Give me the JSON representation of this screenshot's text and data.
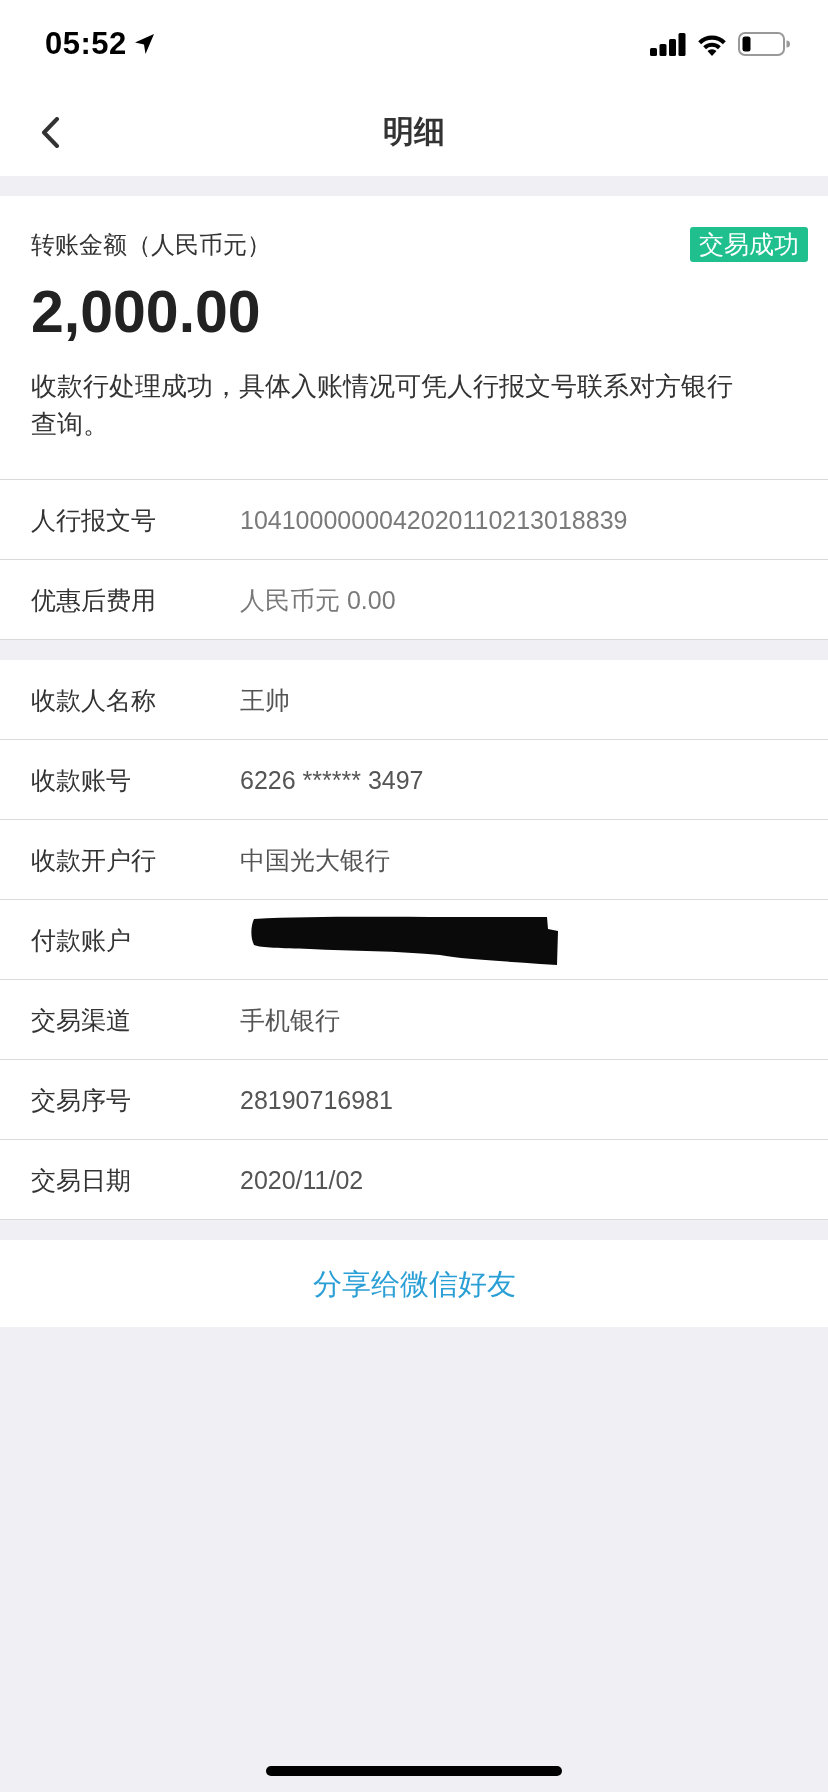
{
  "status_bar": {
    "time": "05:52"
  },
  "nav_bar": {
    "title": "明细"
  },
  "summary": {
    "label": "转账金额（人民币元）",
    "status_badge": "交易成功",
    "amount": "2,000.00",
    "note": "收款行处理成功，具体入账情况可凭人行报文号联系对方银行查询。"
  },
  "sections": [
    {
      "rows": [
        {
          "kind": "text",
          "label": "人行报文号",
          "value": "1041000000042020110213018839"
        },
        {
          "kind": "text",
          "label": "优惠后费用",
          "value": "人民币元 0.00"
        }
      ]
    },
    {
      "rows": [
        {
          "kind": "text",
          "label": "收款人名称",
          "value": "王帅"
        },
        {
          "kind": "text",
          "label": "收款账号",
          "value": "6226 ****** 3497"
        },
        {
          "kind": "text",
          "label": "收款开户行",
          "value": "中国光大银行"
        },
        {
          "kind": "redacted",
          "label": "付款账户"
        },
        {
          "kind": "text",
          "label": "交易渠道",
          "value": "手机银行"
        },
        {
          "kind": "text",
          "label": "交易序号",
          "value": "28190716981"
        },
        {
          "kind": "text",
          "label": "交易日期",
          "value": "2020/11/02"
        }
      ]
    }
  ],
  "share_button": {
    "label": "分享给微信好友"
  }
}
